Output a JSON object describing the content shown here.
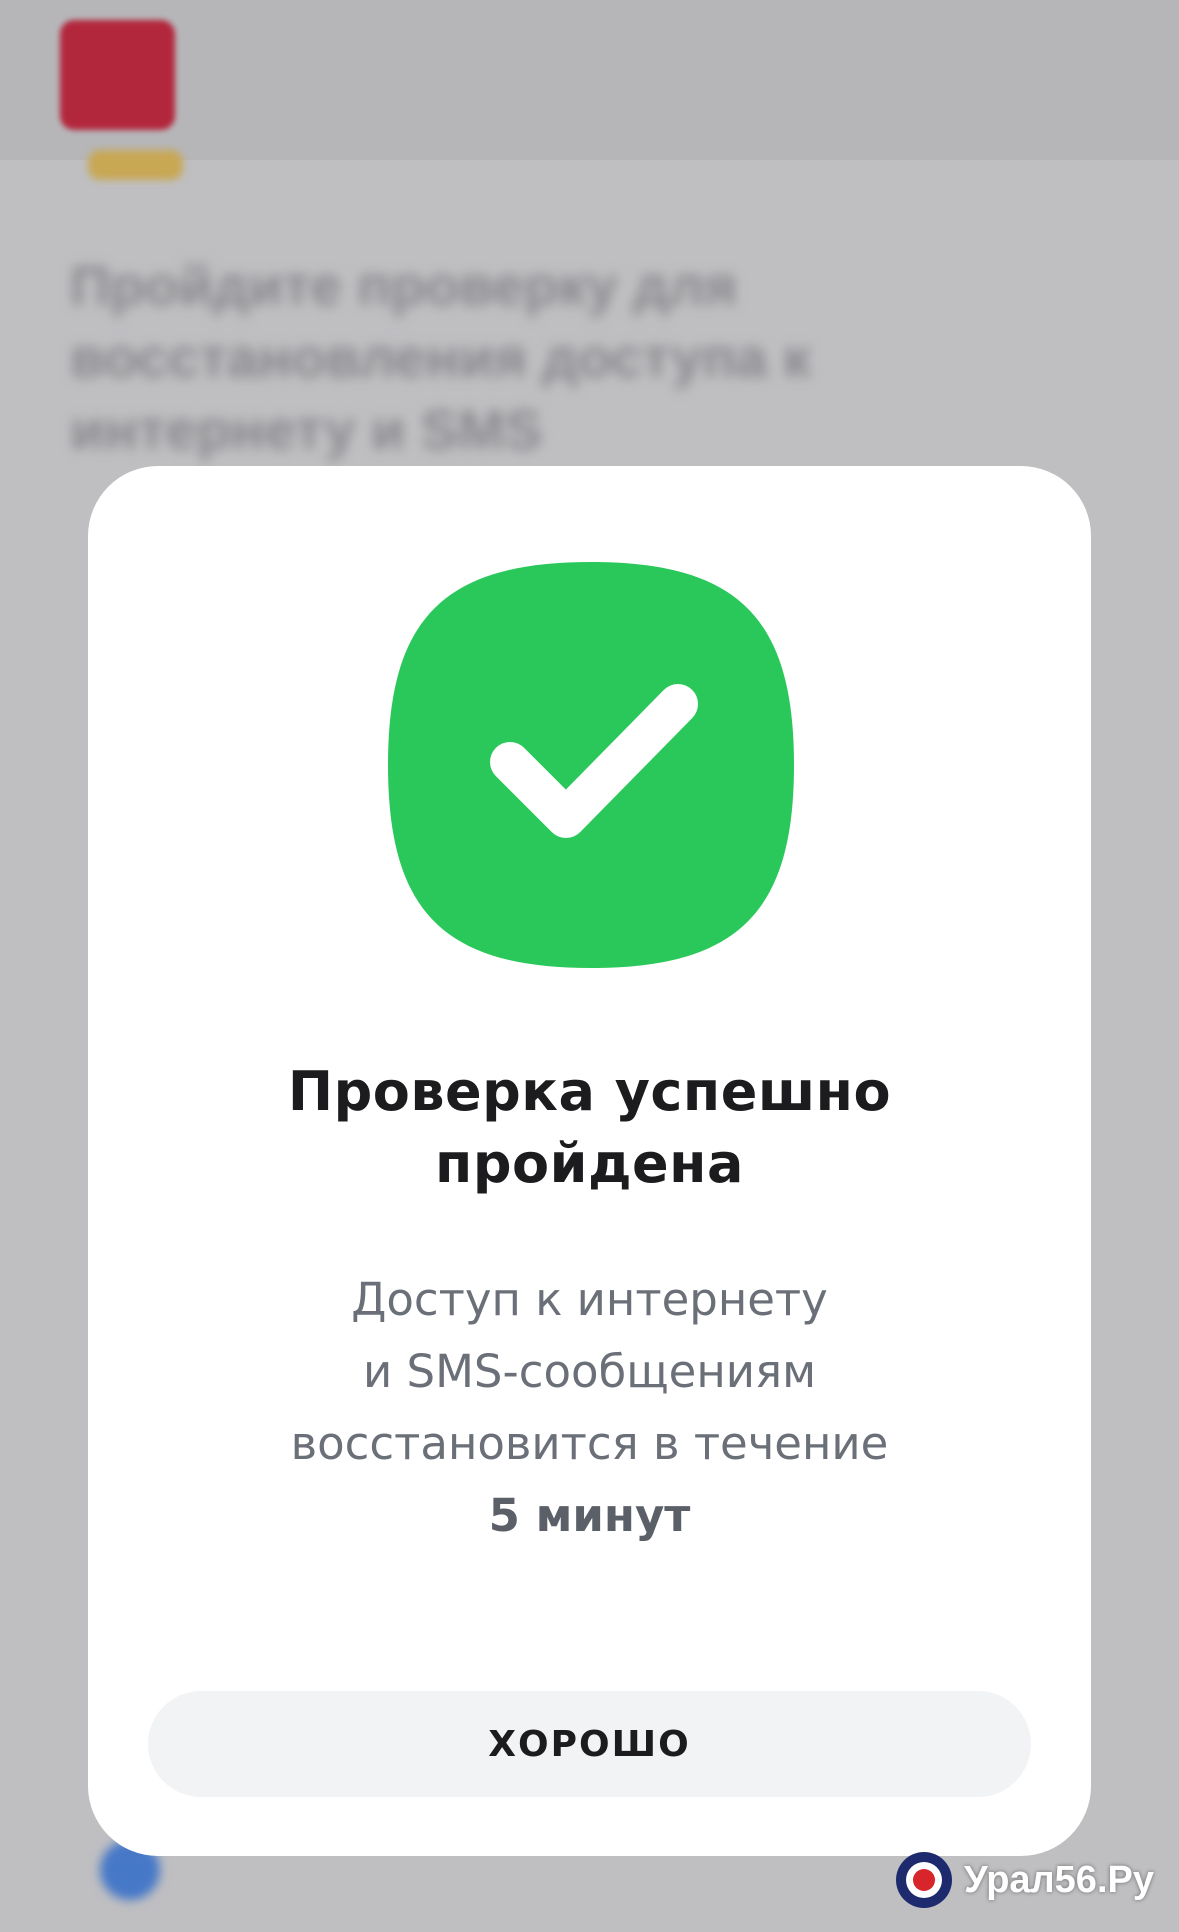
{
  "background": {
    "title": "Пройдите проверку для восстановления доступа к интернету и SMS"
  },
  "modal": {
    "icon": "check-icon",
    "accent_color": "#2ac85a",
    "title_line1": "Проверка успешно",
    "title_line2": "пройдена",
    "text_line1": "Доступ к интернету",
    "text_line2": "и SMS-сообщениям",
    "text_line3": "восстановится в течение",
    "text_strong": "5 минут",
    "button_label": "ХОРОШО"
  },
  "watermark": {
    "text": "Урал56.Ру"
  }
}
